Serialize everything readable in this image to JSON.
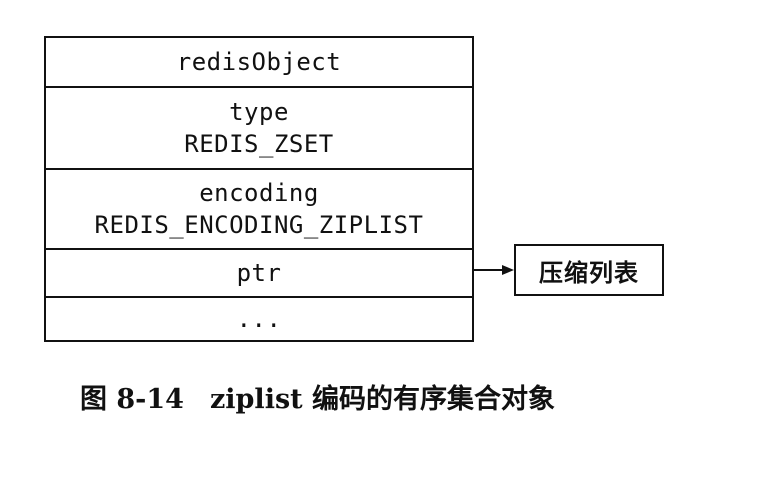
{
  "redis_object": {
    "header": "redisObject",
    "fields": [
      {
        "name": "type",
        "value": "REDIS_ZSET"
      },
      {
        "name": "encoding",
        "value": "REDIS_ENCODING_ZIPLIST"
      }
    ],
    "ptr_label": "ptr",
    "more_label": "..."
  },
  "target": {
    "label": "压缩列表"
  },
  "caption": {
    "figure_number": "图 8-14",
    "text": "ziplist 编码的有序集合对象"
  },
  "colors": {
    "line": "#111111",
    "background": "#ffffff"
  }
}
